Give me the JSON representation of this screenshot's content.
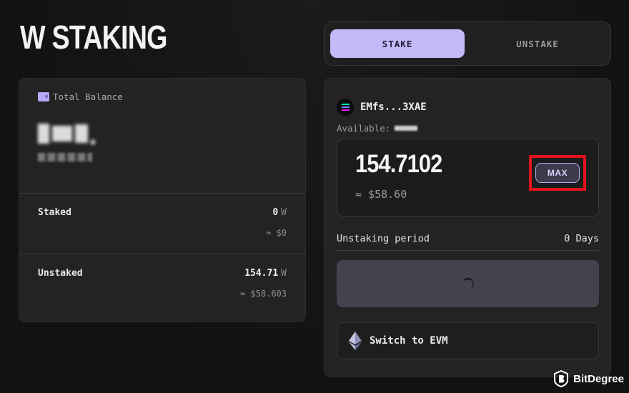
{
  "header": {
    "title": "W STAKING"
  },
  "tabs": [
    {
      "label": "STAKE",
      "active": true
    },
    {
      "label": "UNSTAKE",
      "active": false
    }
  ],
  "balance": {
    "label": "Total Balance",
    "rows": [
      {
        "label": "Staked",
        "amount": "0",
        "unit": "W",
        "usd": "≈ $0"
      },
      {
        "label": "Unstaked",
        "amount": "154.71",
        "unit": "W",
        "usd": "≈ $58.603"
      }
    ]
  },
  "stake_form": {
    "account": "EMfs...3XAE",
    "available_label": "Available:",
    "amount": "154.7102",
    "amount_usd": "≈ $58.60",
    "max_label": "MAX",
    "unstaking_period_label": "Unstaking period",
    "unstaking_period_value": "0 Days",
    "switch_label": "Switch to EVM"
  },
  "watermark": {
    "text": "BitDegree"
  },
  "colors": {
    "accent": "#c5b9f7",
    "highlight": "#e4121c",
    "background": "#131313",
    "card": "#232323"
  },
  "icons": {
    "wallet": "wallet-icon",
    "account": "solana-icon",
    "switch": "ethereum-icon",
    "loading": "spinner-icon",
    "watermark": "bitdegree-logo"
  }
}
